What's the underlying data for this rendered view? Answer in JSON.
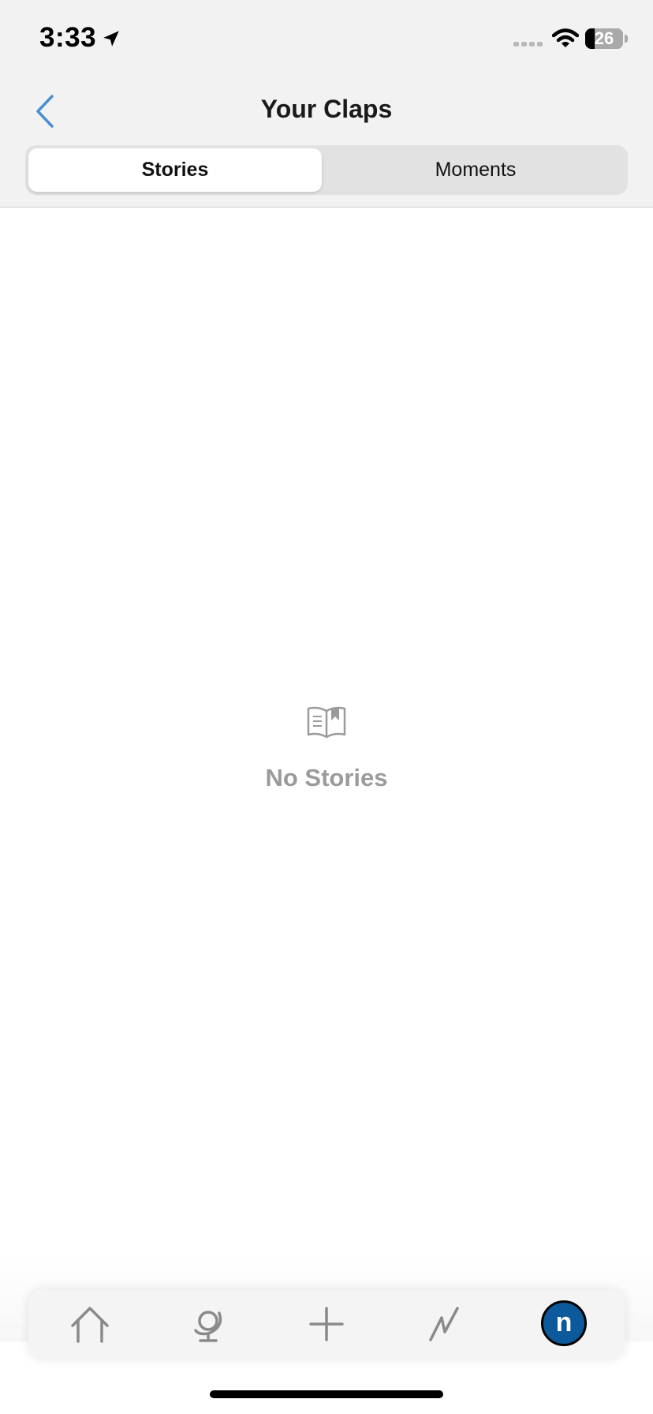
{
  "status_bar": {
    "time": "3:33",
    "battery_percent": "26",
    "battery_level": 0.26
  },
  "nav": {
    "title": "Your Claps",
    "back_icon": "chevron-left-icon",
    "accent_color": "#4a8fcf"
  },
  "segments": [
    {
      "label": "Stories",
      "selected": true
    },
    {
      "label": "Moments",
      "selected": false
    }
  ],
  "empty_state": {
    "icon": "open-book-icon",
    "text": "No Stories"
  },
  "tab_bar": {
    "tabs": [
      {
        "icon": "home-icon"
      },
      {
        "icon": "globe-icon"
      },
      {
        "icon": "plus-icon"
      },
      {
        "icon": "activity-icon"
      },
      {
        "icon": "profile-avatar",
        "initial": "n",
        "color": "#0c5a9c"
      }
    ]
  }
}
